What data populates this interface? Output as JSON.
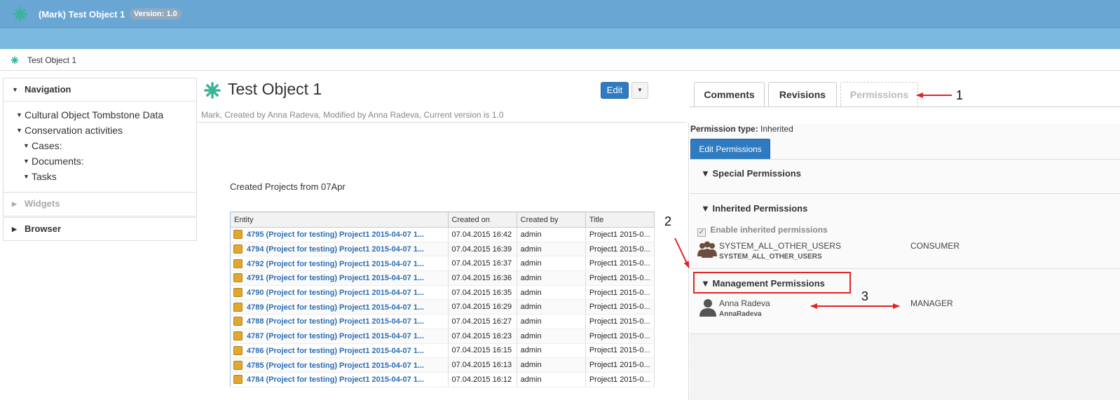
{
  "app": {
    "title": "(Mark) Test Object 1",
    "version": "Version: 1.0"
  },
  "breadcrumb": {
    "label": "Test Object 1"
  },
  "sidebar": {
    "navigation_label": "Navigation",
    "widgets_label": "Widgets",
    "browser_label": "Browser",
    "tree": [
      {
        "label": "Cultural Object Tombstone Data"
      },
      {
        "label": "Conservation activities"
      },
      {
        "label": "Cases:"
      },
      {
        "label": "Documents:"
      },
      {
        "label": "Tasks"
      }
    ]
  },
  "object": {
    "title": "Test Object 1",
    "meta": "Mark, Created by Anna Radeva, Modified by Anna Radeva, Current version is 1.0",
    "edit_label": "Edit",
    "caret": "▼"
  },
  "projects": {
    "title": "Created Projects from 07Apr",
    "columns": [
      "Entity",
      "Created on",
      "Created by",
      "Title"
    ],
    "rows": [
      [
        "4795 (Project for testing) Project1 2015-04-07 1...",
        "07.04.2015 16:42",
        "admin",
        "Project1 2015-0..."
      ],
      [
        "4794 (Project for testing) Project1 2015-04-07 1...",
        "07.04.2015 16:39",
        "admin",
        "Project1 2015-0..."
      ],
      [
        "4792 (Project for testing) Project1 2015-04-07 1...",
        "07.04.2015 16:37",
        "admin",
        "Project1 2015-0..."
      ],
      [
        "4791 (Project for testing) Project1 2015-04-07 1...",
        "07.04.2015 16:36",
        "admin",
        "Project1 2015-0..."
      ],
      [
        "4790 (Project for testing) Project1 2015-04-07 1...",
        "07.04.2015 16:35",
        "admin",
        "Project1 2015-0..."
      ],
      [
        "4789 (Project for testing) Project1 2015-04-07 1...",
        "07.04.2015 16:29",
        "admin",
        "Project1 2015-0..."
      ],
      [
        "4788 (Project for testing) Project1 2015-04-07 1...",
        "07.04.2015 16:27",
        "admin",
        "Project1 2015-0..."
      ],
      [
        "4787 (Project for testing) Project1 2015-04-07 1...",
        "07.04.2015 16:23",
        "admin",
        "Project1 2015-0..."
      ],
      [
        "4786 (Project for testing) Project1 2015-04-07 1...",
        "07.04.2015 16:15",
        "admin",
        "Project1 2015-0..."
      ],
      [
        "4785 (Project for testing) Project1 2015-04-07 1...",
        "07.04.2015 16:13",
        "admin",
        "Project1 2015-0..."
      ],
      [
        "4784 (Project for testing) Project1 2015-04-07 1...",
        "07.04.2015 16:12",
        "admin",
        "Project1 2015-0..."
      ]
    ]
  },
  "tabs": {
    "comments": "Comments",
    "revisions": "Revisions",
    "permissions": "Permissions"
  },
  "permissions": {
    "type_label": "Permission type:",
    "type_value": "Inherited",
    "edit_label": "Edit Permissions",
    "special_label": "Special Permissions",
    "inherited_label": "Inherited Permissions",
    "enable_inherited_label": "Enable inherited permissions",
    "inherited_user_name": "SYSTEM_ALL_OTHER_USERS",
    "inherited_user_login": "SYSTEM_ALL_OTHER_USERS",
    "inherited_role": "CONSUMER",
    "management_label": "Management Permissions",
    "mgmt_user_name": "Anna Radeva",
    "mgmt_user_login": "AnnaRadeva",
    "mgmt_role": "MANAGER"
  },
  "annotations": {
    "one": "1",
    "two": "2",
    "three": "3"
  },
  "colors": {
    "accent": "#2f7bbf",
    "header": "#6aa6d4",
    "annotation": "#e02424"
  }
}
